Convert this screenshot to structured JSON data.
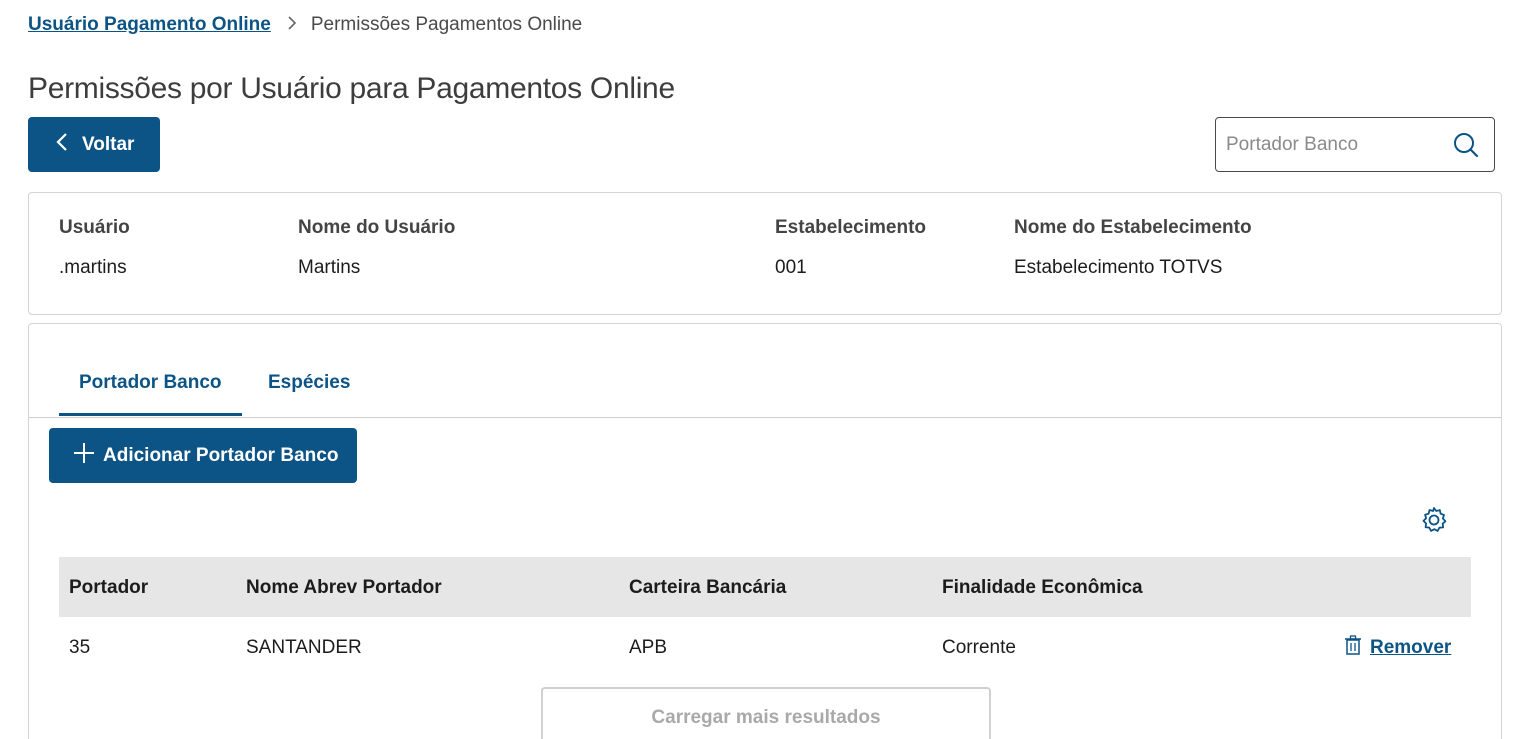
{
  "breadcrumb": {
    "link": "Usuário Pagamento Online",
    "separator": ">",
    "current": "Permissões Pagamentos Online"
  },
  "page": {
    "title": "Permissões por Usuário para Pagamentos Online"
  },
  "back_button": {
    "label": "Voltar",
    "icon": "chevron-left-icon"
  },
  "search": {
    "placeholder": "Portador Banco",
    "value": "",
    "icon": "search-icon"
  },
  "user_info": {
    "columns": [
      {
        "label": "Usuário",
        "value": ".martins"
      },
      {
        "label": "Nome do Usuário",
        "value": "Martins"
      },
      {
        "label": "Estabelecimento",
        "value": "001"
      },
      {
        "label": "Nome do Estabelecimento",
        "value": "Estabelecimento TOTVS"
      }
    ]
  },
  "tabs": [
    {
      "label": "Portador Banco",
      "active": true
    },
    {
      "label": "Espécies",
      "active": false
    }
  ],
  "add_button": {
    "label": "Adicionar Portador Banco",
    "icon": "plus-icon"
  },
  "settings": {
    "icon": "gear-icon"
  },
  "table": {
    "headers": [
      "Portador",
      "Nome Abrev Portador",
      "Carteira Bancária",
      "Finalidade Econômica"
    ],
    "rows": [
      {
        "portador": "35",
        "nome": "SANTANDER",
        "carteira": "APB",
        "finalidade": "Corrente",
        "action": "Remover"
      }
    ]
  },
  "load_more": {
    "label": "Carregar mais resultados"
  },
  "colors": {
    "primary": "#0c5486",
    "header_bg": "#e6e6e6",
    "border": "#d4d4d4"
  }
}
